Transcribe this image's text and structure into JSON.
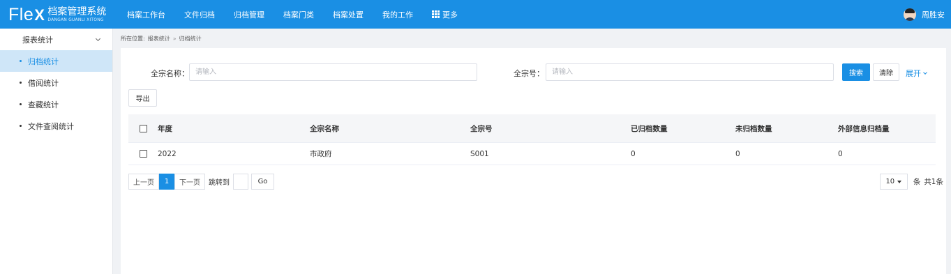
{
  "app": {
    "logo_text": "Fle",
    "logo_x": "X",
    "title_cn": "档案管理系统",
    "title_en": "DANGAN GUANLI XITONG"
  },
  "nav": {
    "items": [
      "档案工作台",
      "文件归档",
      "归档管理",
      "档案门类",
      "档案处置",
      "我的工作"
    ],
    "more_label": "更多"
  },
  "user": {
    "name": "周胜安"
  },
  "sidebar": {
    "group_label": "报表统计",
    "items": [
      {
        "label": "归档统计",
        "active": true
      },
      {
        "label": "借阅统计",
        "active": false
      },
      {
        "label": "查藏统计",
        "active": false
      },
      {
        "label": "文件查阅统计",
        "active": false
      }
    ]
  },
  "breadcrumb": {
    "prefix": "所在位置:",
    "items": [
      "报表统计",
      "归档统计"
    ],
    "separator": "»"
  },
  "filters": {
    "name_label": "全宗名称：",
    "name_placeholder": "请输入",
    "number_label": "全宗号：",
    "number_placeholder": "请输入",
    "search_label": "搜索",
    "clear_label": "清除",
    "expand_label": "展开",
    "export_label": "导出"
  },
  "table": {
    "headers": [
      "年度",
      "全宗名称",
      "全宗号",
      "已归档数量",
      "未归档数量",
      "外部信息归档量"
    ],
    "rows": [
      [
        "2022",
        "市政府",
        "S001",
        "0",
        "0",
        "0"
      ]
    ]
  },
  "pagination": {
    "prev_label": "上一页",
    "current_page": "1",
    "next_label": "下一页",
    "jump_label": "跳转到",
    "go_label": "Go",
    "page_size": "10",
    "unit_label": "条",
    "total_label": "共1条"
  },
  "colors": {
    "primary": "#1a8fe4",
    "sidebar_active_bg": "#cfe6f8"
  }
}
